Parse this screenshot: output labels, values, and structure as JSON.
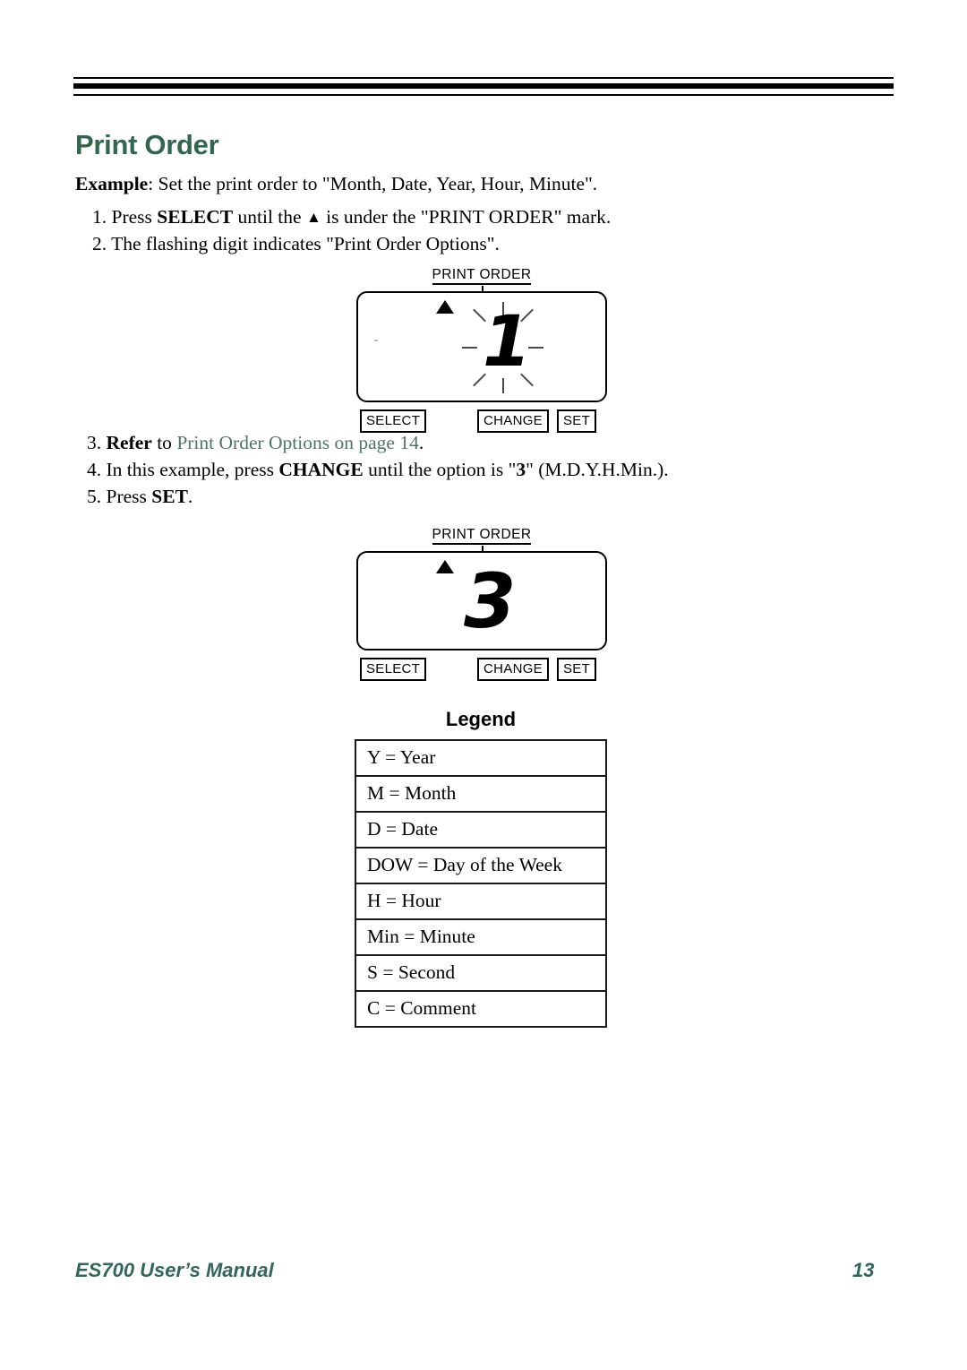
{
  "page": {
    "title": "Print Order",
    "title_color": "#33664f",
    "example_prefix": "Example",
    "example_text": ": Set the print order to \"Month, Date, Year, Hour, Minute\"."
  },
  "steps": {
    "step1": {
      "number": "1.",
      "part_a": "Press ",
      "bold": "SELECT",
      "part_b": " until the ",
      "triangle": "▲",
      "part_c": " is under the \"PRINT ORDER\" mark."
    },
    "step2": {
      "number": "2.",
      "text": "The flashing digit indicates \"Print Order Options\"."
    },
    "step3": {
      "number": "3.",
      "bold": "Refer",
      "part_a": " to ",
      "link": "Print Order Options on page 14",
      "link_color": "#4f7568",
      "part_b": "."
    },
    "step4": {
      "number": "4.",
      "part_a": "In this example, press ",
      "bold": "CHANGE",
      "part_b": " until the option is \"",
      "bold2": "3",
      "part_c": "\" (M.D.Y.H.Min.)."
    },
    "step5": {
      "number": "5.",
      "part_a": "Press ",
      "bold": "SET",
      "part_b": "."
    }
  },
  "figures": [
    {
      "caption": "PRINT ORDER",
      "marker_icon": "up-triangle-indicator",
      "display_value": "1",
      "flashing": true,
      "buttons": [
        "SELECT",
        "CHANGE",
        "SET"
      ]
    },
    {
      "caption": "PRINT ORDER",
      "marker_icon": "up-triangle-indicator",
      "display_value": "3",
      "flashing": false,
      "buttons": [
        "SELECT",
        "CHANGE",
        "SET"
      ]
    }
  ],
  "legend": {
    "title": "Legend",
    "rows": [
      "Y = Year",
      "M = Month",
      "D = Date",
      "DOW = Day of the Week",
      "H = Hour",
      "Min = Minute",
      "S = Second",
      "C = Comment"
    ]
  },
  "footer": {
    "manual_name": "ES700 User’s Manual",
    "page_number": "13",
    "color": "#33665a"
  }
}
